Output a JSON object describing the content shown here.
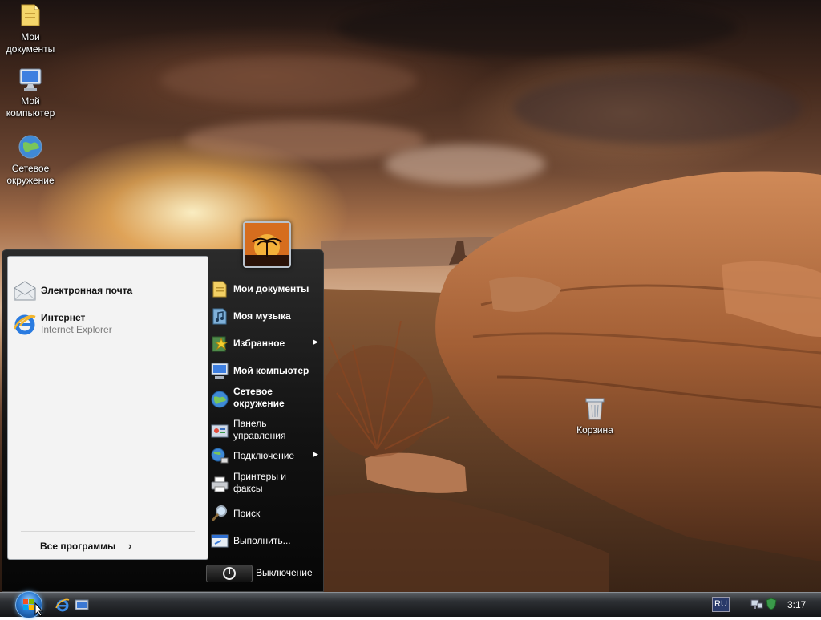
{
  "desktop": {
    "icons": [
      {
        "label": "Мои документы",
        "icon": "folder-icon"
      },
      {
        "label": "Мой компьютер",
        "icon": "computer-icon"
      },
      {
        "label": "Сетевое окружение",
        "icon": "network-globe-icon"
      },
      {
        "label": "Корзина",
        "icon": "recycle-bin-icon"
      }
    ]
  },
  "start_menu": {
    "pinned": [
      {
        "title": "Электронная почта",
        "subtitle": "",
        "icon": "mail-icon"
      },
      {
        "title": "Интернет",
        "subtitle": "Internet Explorer",
        "icon": "internet-explorer-icon"
      }
    ],
    "all_programs_label": "Все программы",
    "right_items": [
      {
        "label": "Мои документы",
        "icon": "documents-icon",
        "bold": true
      },
      {
        "label": "Моя музыка",
        "icon": "music-icon",
        "bold": true
      },
      {
        "label": "Избранное",
        "icon": "favorites-star-icon",
        "bold": true,
        "submenu": true
      },
      {
        "label": "Мой компьютер",
        "icon": "computer-icon",
        "bold": true
      },
      {
        "label": "Сетевое окружение",
        "icon": "network-globe-icon",
        "bold": true
      },
      {
        "label": "Панель управления",
        "icon": "control-panel-icon",
        "bold": false
      },
      {
        "label": "Подключение",
        "icon": "connect-icon",
        "bold": false,
        "submenu": true
      },
      {
        "label": "Принтеры и факсы",
        "icon": "printer-icon",
        "bold": false
      },
      {
        "label": "Поиск",
        "icon": "search-icon",
        "bold": false
      },
      {
        "label": "Выполнить...",
        "icon": "run-icon",
        "bold": false
      }
    ],
    "power_label": "Выключение"
  },
  "taskbar": {
    "quick_launch": [
      "internet-explorer-icon",
      "show-desktop-icon"
    ],
    "language": "RU",
    "clock": "3:17"
  }
}
